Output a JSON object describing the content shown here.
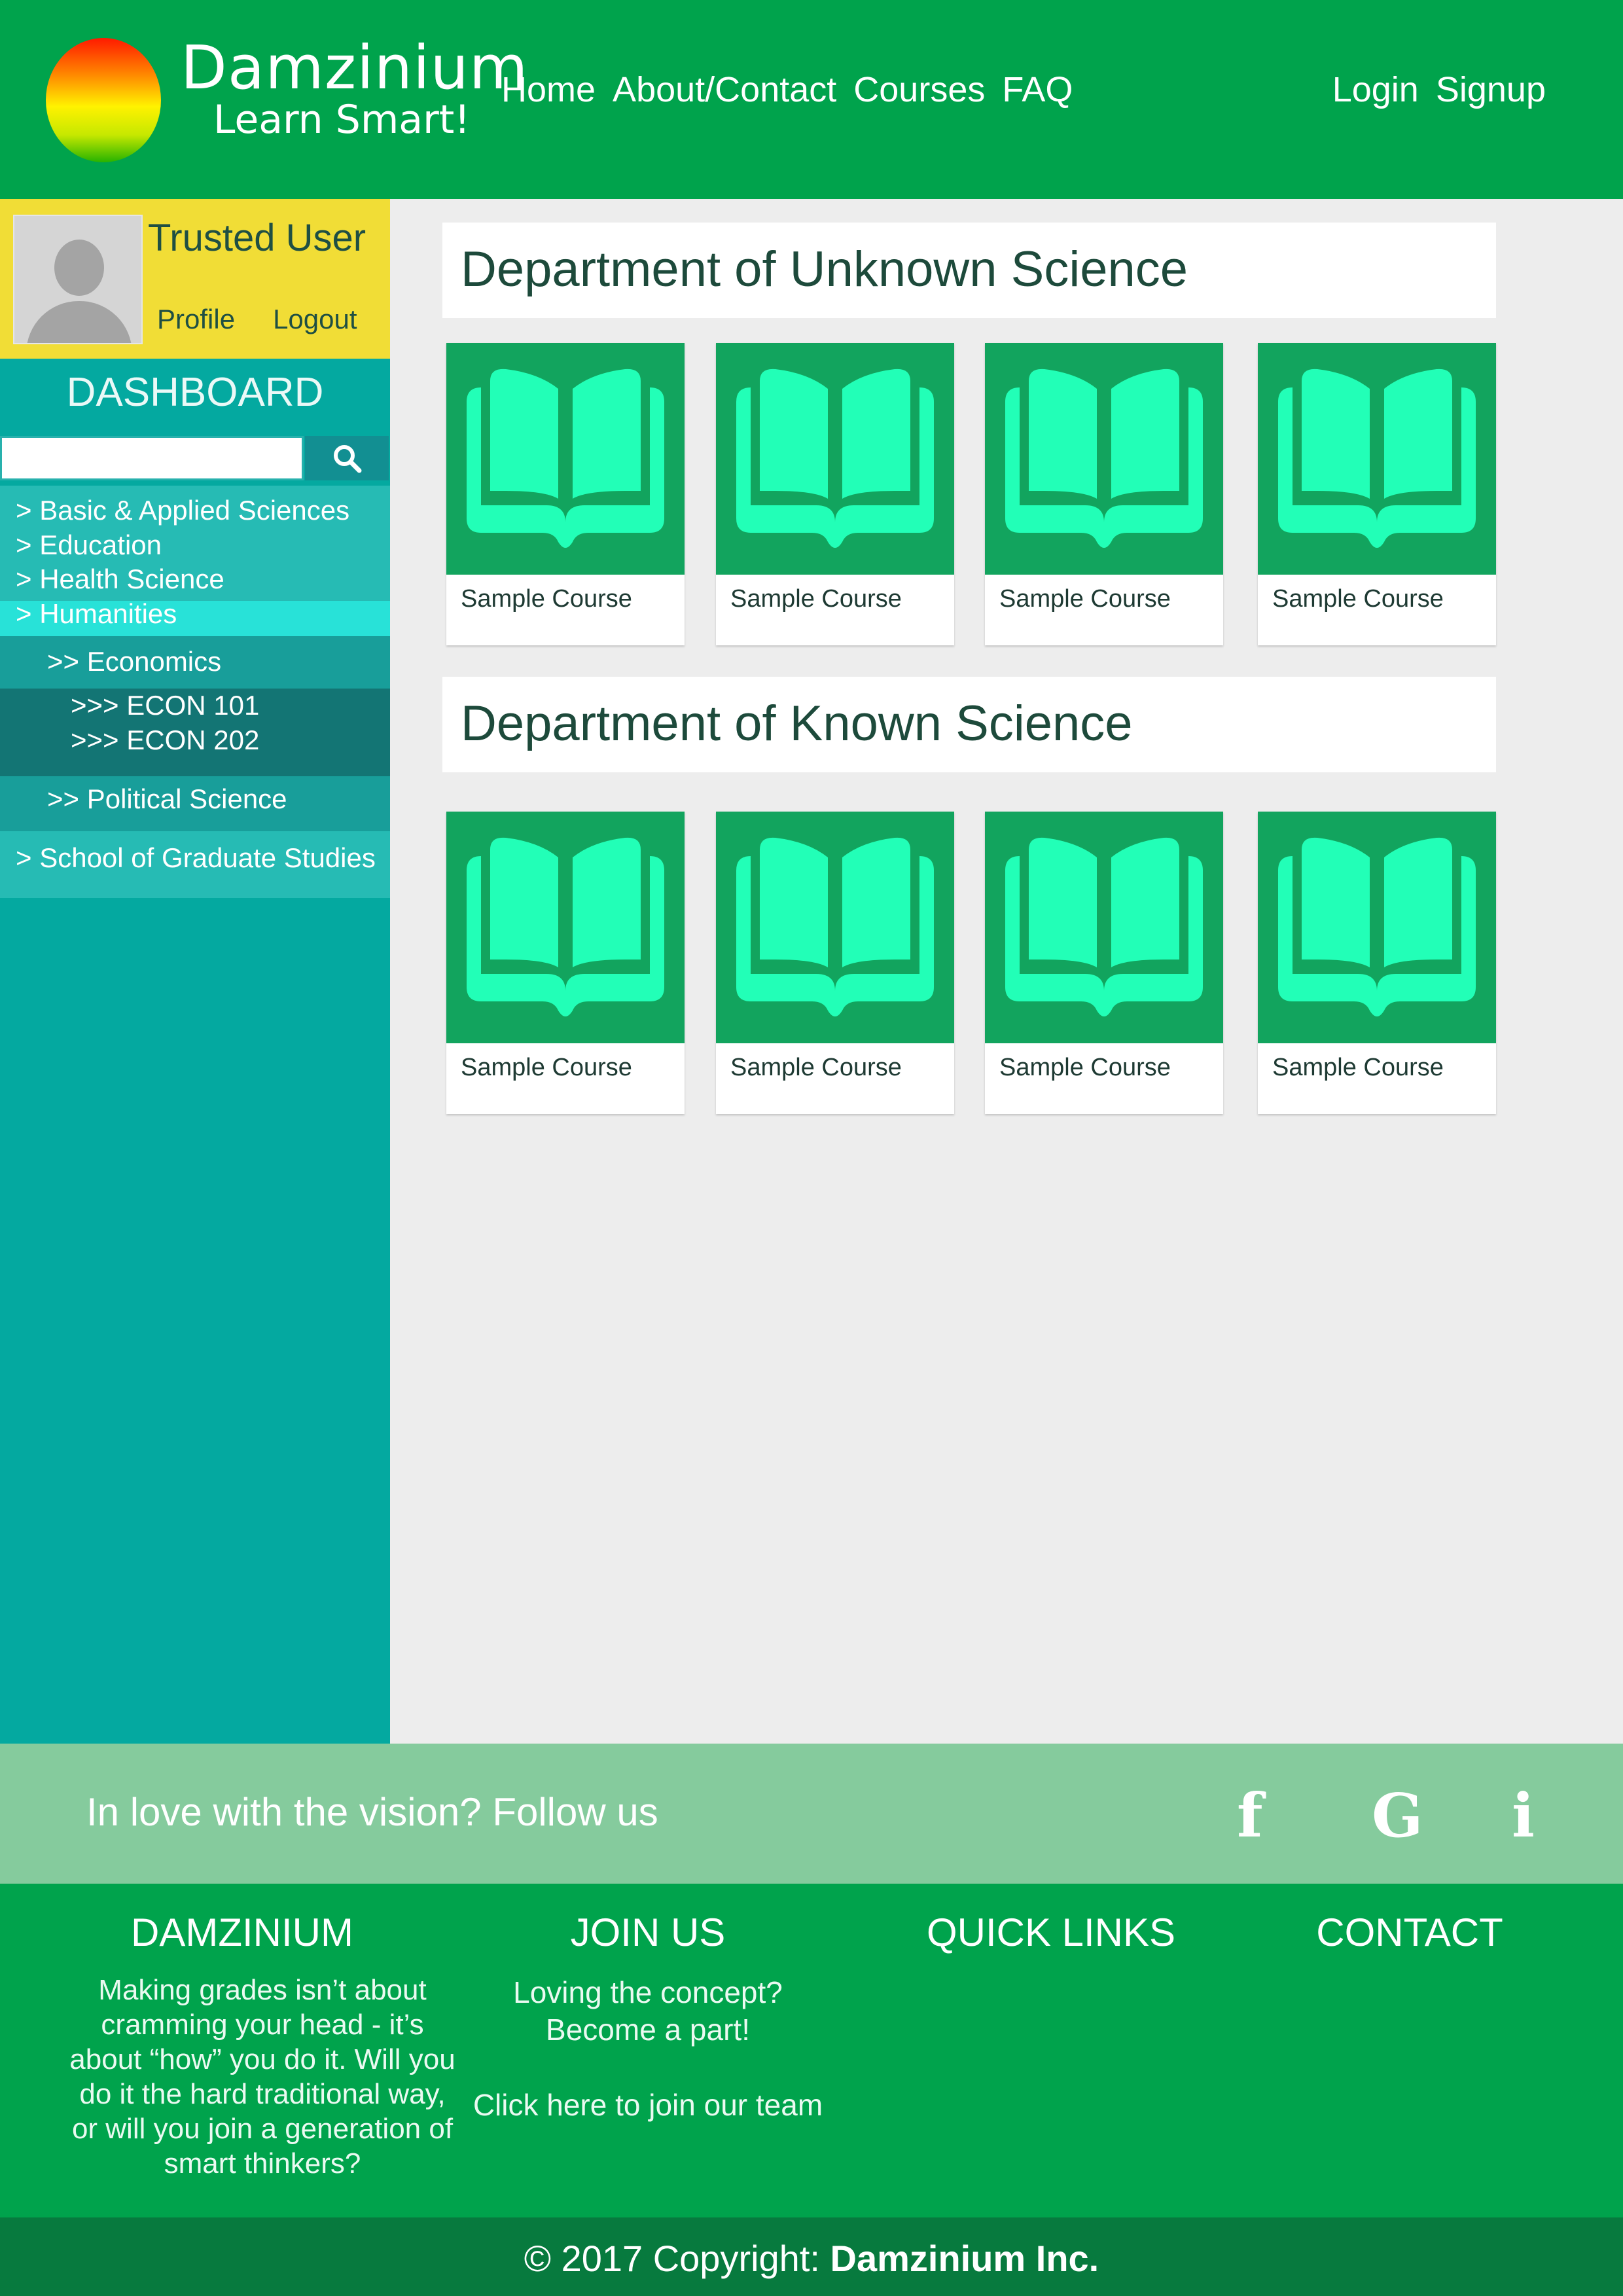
{
  "brand": {
    "name": "Damzinium",
    "tagline": "Learn Smart!"
  },
  "nav": {
    "home": "Home",
    "about": "About/Contact",
    "courses": "Courses",
    "faq": "FAQ"
  },
  "auth": {
    "login": "Login",
    "signup": "Signup"
  },
  "user": {
    "name": "Trusted User",
    "profile": "Profile",
    "logout": "Logout"
  },
  "sidebar": {
    "title": "DASHBOARD",
    "search_value": "",
    "categories": [
      "> Basic & Applied Sciences",
      "> Education",
      "> Health Science",
      "> Humanities"
    ],
    "sub_economics": ">> Economics",
    "courses": [
      ">>> ECON 101",
      ">>> ECON 202"
    ],
    "sub_political": ">> Political Science",
    "graduate": "> School of Graduate Studies"
  },
  "departments": [
    {
      "title": "Department of Unknown Science",
      "courses": [
        "Sample Course",
        "Sample Course",
        "Sample Course",
        "Sample Course"
      ]
    },
    {
      "title": "Department of Known Science",
      "courses": [
        "Sample Course",
        "Sample Course",
        "Sample Course",
        "Sample Course"
      ]
    }
  ],
  "follow": {
    "text": "In love with the vision? Follow us",
    "icons": [
      "facebook-icon",
      "google-icon",
      "info-icon"
    ],
    "glyphs": [
      "f",
      "G",
      "i"
    ]
  },
  "footer": {
    "col1_title": "DAMZINIUM",
    "col1_text": "Making grades isn’t about cramming your head - it’s about “how” you do it. Will you do it the hard traditional way, or will you join a generation of smart thinkers?",
    "col2_title": "JOIN US",
    "col2_text": "Loving the concept? Become a part!",
    "col2_link": "Click here to join our team",
    "col3_title": "QUICK LINKS",
    "col4_title": "CONTACT"
  },
  "copyright": {
    "prefix": "© 2017 Copyright: ",
    "company": "Damzinium Inc."
  },
  "colors": {
    "header": "#00a34c",
    "sidebar": "#04a9a0",
    "user_box": "#f1dd36",
    "card_thumb": "#12a45e",
    "book": "#22ffb7",
    "follow_bar": "#85cb9d",
    "copyright_bar": "#077a3e"
  }
}
